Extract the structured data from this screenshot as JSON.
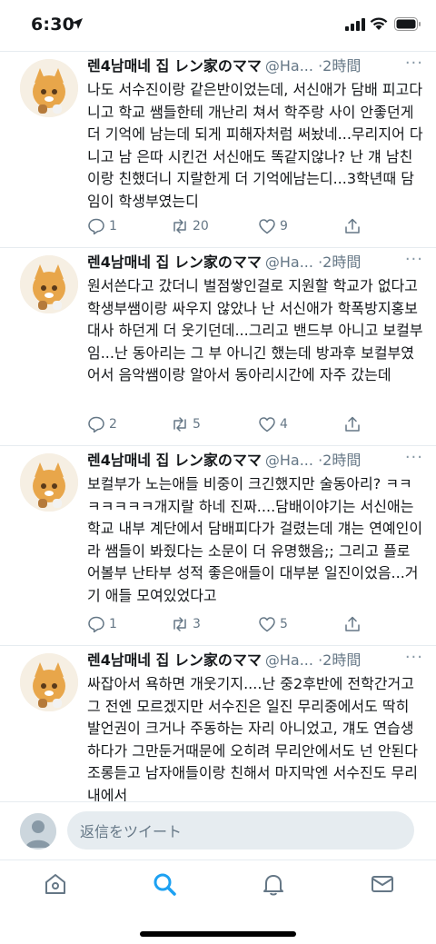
{
  "status_bar": {
    "time": "6:30"
  },
  "colors": {
    "accent": "#1da1f2",
    "muted": "#657786",
    "icon": "#657786"
  },
  "tweets": [
    {
      "name": "렌4남매네 집 レン家のママ",
      "handle": "@Ha...",
      "dot": "·",
      "ago": "2時間",
      "more": "···",
      "text": "나도 서수진이랑 같은반이었는데, 서신애가 담배 피고다니고 학교 쌤들한테 개난리 쳐서 학주랑 사이 안좋던게 더 기억에 남는데 되게 피해자처럼 써놨네...무리지어 다니고 남 은따 시킨건 서신애도 똑같지않나? 난 걔 남친이랑 친했더니 지랄한게 더 기억에남는디...3학년때 담임이 학생부였는디",
      "replies": "1",
      "retweets": "20",
      "likes": "9"
    },
    {
      "name": "렌4남매네 집 レン家のママ",
      "handle": "@Ha...",
      "dot": "·",
      "ago": "2時間",
      "more": "···",
      "text": "원서쓴다고 갔더니 벌점쌓인걸로 지원할 학교가 없다고 학생부쌤이랑 싸우지 않았나 난 서신애가 학폭방지홍보대사 하던게 더 웃기던데...그리고 밴드부 아니고 보컬부임...난 동아리는 그 부 아니긴 했는데 방과후 보컬부였어서 음악쌤이랑 알아서 동아리시간에 자주 갔는데",
      "replies": "2",
      "retweets": "5",
      "likes": "4"
    },
    {
      "name": "렌4남매네 집 レン家のママ",
      "handle": "@Ha...",
      "dot": "·",
      "ago": "2時間",
      "more": "···",
      "text": "보컬부가 노는애들 비중이 크긴했지만 술동아리? ㅋㅋㅋㅋㅋㅋㅋ개지랄 하네 진짜....담배이야기는 서신애는 학교 내부 계단에서 담배피다가 걸렸는데 걔는 연예인이라 쌤들이 봐줬다는 소문이 더 유명했음;; 그리고 플로어볼부 난타부 성적 좋은애들이 대부분 일진이었음...거기 애들 모여있었다고",
      "replies": "1",
      "retweets": "3",
      "likes": "5"
    },
    {
      "name": "렌4남매네 집 レン家のママ",
      "handle": "@Ha...",
      "dot": "·",
      "ago": "2時間",
      "more": "···",
      "text": "싸잡아서 욕하면 개웃기지....난 중2후반에 전학간거고 그 전엔 모르겠지만 서수진은 일진 무리중에서도 딱히 발언권이 크거나 주동하는 자리 아니었고, 걔도 연습생하다가 그만둔거때문에 오히려 무리안에서도 넌 안된다 조롱듣고 남자애들이랑 친해서 마지막엔 서수진도 무리내에서",
      "replies": "",
      "retweets": "",
      "likes": ""
    }
  ],
  "reply_bar": {
    "placeholder": "返信をツイート"
  },
  "tab_bar": {
    "icons": [
      "home-icon",
      "search-icon",
      "notifications-icon",
      "messages-icon"
    ]
  }
}
